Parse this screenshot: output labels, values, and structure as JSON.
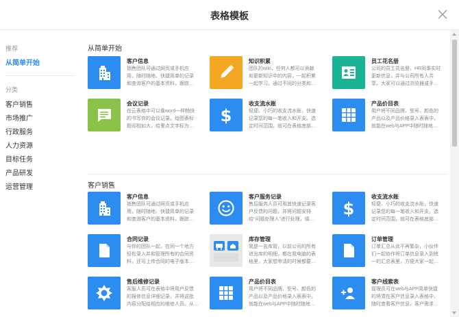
{
  "dialog": {
    "title": "表格模板"
  },
  "sidebar": {
    "recommend_label": "推荐",
    "quick_start": "从简单开始",
    "category_label": "分类",
    "categories": [
      "客户销售",
      "市场推广",
      "行政服务",
      "人力资源",
      "目标任务",
      "产品研发",
      "运营管理"
    ]
  },
  "sections": [
    {
      "title": "从简单开始",
      "cards": [
        {
          "name": "客户信息",
          "icon": "building-icon",
          "color": "#2d8cf0",
          "desc": [
            "销售团队可通过网页或手机应",
            "用，随时随地、快捷简单的记录",
            "和查询客户的基本资料，跟踪…"
          ]
        },
        {
          "name": "知识积累",
          "icon": "pencil-icon",
          "color": "#f5a623",
          "desc": [
            "团队的wiki，任何人都可以贡献",
            "和更新知识中的内容，一起积累",
            "一起学习。通过不同的分类和…"
          ]
        },
        {
          "name": "员工花名册",
          "icon": "id-card-icon",
          "color": "#1ab394",
          "desc": [
            "公司的员工花名册，HR同事实时",
            "更新信息，并与公司所有人共",
            "享。大家可以通过浏览器或手…"
          ]
        },
        {
          "name": "会议记录",
          "icon": "chat-icon",
          "color": "#8bc34a",
          "desc": [
            "在云表格中可以像word一样畅快",
            "的书写你的会议记录。给图表标",
            "题却相如大，给重点文字标为…"
          ]
        },
        {
          "name": "收支流水账",
          "icon": "dollar-icon",
          "color": "#2d8cf0",
          "desc": [
            "轻便、小巧的收支流水账，快速",
            "记录您的每一笔收入和开支。选",
            "定时间范围，就可在表格底部…"
          ]
        },
        {
          "name": "产品价目表",
          "icon": "grid-icon",
          "color": "#2d8cf0",
          "desc": [
            "用户将不同品牌、型号、颜色的",
            "产品以及产品价格录入表表中，",
            "就能在web与APP中随时随地…"
          ]
        }
      ]
    },
    {
      "title": "客户销售",
      "cards": [
        {
          "name": "客户信息",
          "icon": "building-icon",
          "color": "#2d8cf0",
          "desc": [
            "销售团队可通过网页或手机应",
            "用，随时随地、快捷简单的记录",
            "和查询客户的基本资料，跟踪…"
          ]
        },
        {
          "name": "客户服务记录",
          "icon": "smile-icon",
          "color": "#2d8cf0",
          "desc": [
            "售后服务人员可用其快速记录客",
            "户反馈的问题，并将问题安排",
            "给“问题处理人”进行处理，填…"
          ]
        },
        {
          "name": "收支流水账",
          "icon": "dollar-icon",
          "color": "#2d8cf0",
          "desc": [
            "轻便、小巧的收支流水账，快速",
            "记录您的每一笔收入和开支。选",
            "定时间范围，就可在表格底部…"
          ]
        },
        {
          "name": "合同记录",
          "icon": "document-icon",
          "color": "#2d8cf0",
          "desc": [
            "与你的团队一起，在同一个地方",
            "轻松录入并和管理所有的合同资",
            "料，还可上传合同的电子版本…"
          ]
        },
        {
          "name": "库存管理",
          "icon": "store-icon",
          "color": "#e8e8e8",
          "desc": [
            "我是一名库管，以前公司的所有",
            "进出库的明细，都在我电脑的表",
            "格里，大家想申请的时候都要…"
          ]
        },
        {
          "name": "订单管理",
          "icon": "document-icon",
          "color": "#2d8cf0",
          "desc": [
            "订单汇总从此不再繁杂，小伙伴",
            "们一起协作将订单信息录入到统",
            "一的汇总表里，方便大家一起…"
          ]
        },
        {
          "name": "售后维修记录",
          "icon": "gear-icon",
          "color": "#2d8cf0",
          "desc": [
            "客服人员可在表格中将用户反馈",
            "的报修信息详细记录，并将这批",
            "内容分配给相应的维修人员。从…"
          ]
        },
        {
          "name": "产品价目表",
          "icon": "grid-icon",
          "color": "#2d8cf0",
          "desc": [
            "用户将不同品牌、型号、颜色的",
            "产品以及产品价格录入表表中，",
            "就能在web与APP中随时随地…"
          ]
        },
        {
          "name": "客户线索表",
          "icon": "add-user-icon",
          "color": "#2d8cf0",
          "desc": [
            "管理员可在web与APP简单快捷",
            "的将潜在客户信息录入表格中，",
            "随时查看客户信息，客户需求…"
          ]
        }
      ]
    }
  ]
}
